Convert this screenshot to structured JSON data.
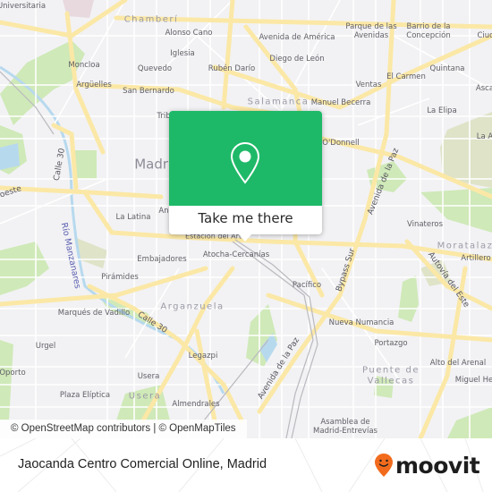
{
  "map": {
    "labels": {
      "universitaria": "Universitaria",
      "chamberi": "Chamberí",
      "alonso_cano": "Alonso Cano",
      "avenida_america": "Avenida de América",
      "parque_avenidas": "Parque de las\nAvenidas",
      "barrio_concepcion": "Barrio de la\nConcepción",
      "ciudad_lineal": "Ciud",
      "iglesia": "Iglesia",
      "diego_de_leon": "Diego de León",
      "moncloa": "Moncloa",
      "quevedo": "Quevedo",
      "ruben_dario": "Rubén Darío",
      "quintana": "Quintana",
      "el_carmen": "El Carmen",
      "arguelles": "Argüelles",
      "san_bernardo": "San Bernardo",
      "ventas": "Ventas",
      "ascao": "Asca",
      "salamanca": "Salamanca",
      "manuel_becerra": "Manuel Becerra",
      "tribunal": "Trib",
      "la_elipa": "La Elipa",
      "la_almudena": "La A",
      "odonnell": "O'Donnell",
      "madrid": "Madrid",
      "calle_30_north": "Calle 30",
      "oeste": "oeste",
      "avenida_paz_north": "Avenida de la Paz",
      "la_latina": "La Latina",
      "anton_martin": "An",
      "vinateros": "Vinateros",
      "estacion_del_arte": "Estación del Arte",
      "moratalaz": "Moratalaz",
      "artilleros": "Artillero",
      "embajadores": "Embajadores",
      "atocha_cercanias": "Atocha-Cercanías",
      "bypass_sur": "Bypass Sur",
      "autovia_este": "Autovía del Este",
      "rio_manzanares": "Río Manzanares",
      "piramides": "Pirámides",
      "pacifico": "Pacífico",
      "arganzuela": "Arganzuela",
      "marques_vadillo": "Marqués de Vadillo",
      "calle_30_south": "Calle 30",
      "nueva_numancia": "Nueva Numancia",
      "urgel": "Urgel",
      "portazgo": "Portazgo",
      "legazpi": "Legazpi",
      "alto_arenal": "Alto del Arenal",
      "oporto": "Oporto",
      "usera_station": "Usera",
      "puente_vallecas": "Puente de\nVallecas",
      "miguel_hernandez": "Miguel He",
      "plaza_eliptica": "Plaza Elíptica",
      "usera_district": "Usera",
      "almendrales": "Almendrales",
      "avenida_paz_south": "Avenida de la Paz",
      "asamblea": "Asamblea de\nMadrid-Entrevías"
    },
    "attribution": "© OpenStreetMap contributors | © OpenMapTiles",
    "colors": {
      "background": "#f2f2f4",
      "major_road": "#fbe8a6",
      "minor_road": "#ffffff",
      "park": "#cfe9b8",
      "water": "#b7d9ee",
      "special_area": "#dfe3c8"
    }
  },
  "popup": {
    "icon": "map-pin-icon",
    "action_label": "Take me there",
    "color": "#1eb968"
  },
  "footer": {
    "place_title": "Jaocanda Centro Comercial Online, Madrid",
    "brand": {
      "name": "moovit",
      "icon": "moovit-smiley-pin-icon",
      "color": "#f26b1d"
    }
  }
}
